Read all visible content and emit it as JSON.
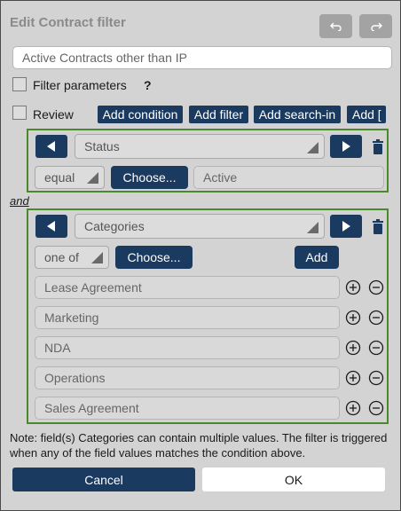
{
  "dialog": {
    "title": "Edit Contract filter",
    "filter_name": "Active Contracts other than IP",
    "filter_parameters_label": "Filter parameters",
    "help_mark": "?",
    "review_label": "Review"
  },
  "toolbar": {
    "add_condition": "Add condition",
    "add_filter": "Add filter",
    "add_search_in": "Add search-in",
    "add_bracket": "Add ["
  },
  "condition1": {
    "field": "Status",
    "operator": "equal",
    "choose": "Choose...",
    "value": "Active"
  },
  "connector": "and",
  "condition2": {
    "field": "Categories",
    "operator": "one of",
    "choose": "Choose...",
    "add": "Add",
    "values": [
      "Lease Agreement",
      "Marketing",
      "NDA",
      "Operations",
      "Sales Agreement"
    ]
  },
  "note": "Note: field(s) Categories can contain multiple values. The filter is triggered when any of the field values matches the condition above.",
  "footer": {
    "cancel": "Cancel",
    "ok": "OK"
  },
  "colors": {
    "navy": "#1a3a5f",
    "group_border": "#4a8a2a",
    "background": "#d3d3d3"
  }
}
